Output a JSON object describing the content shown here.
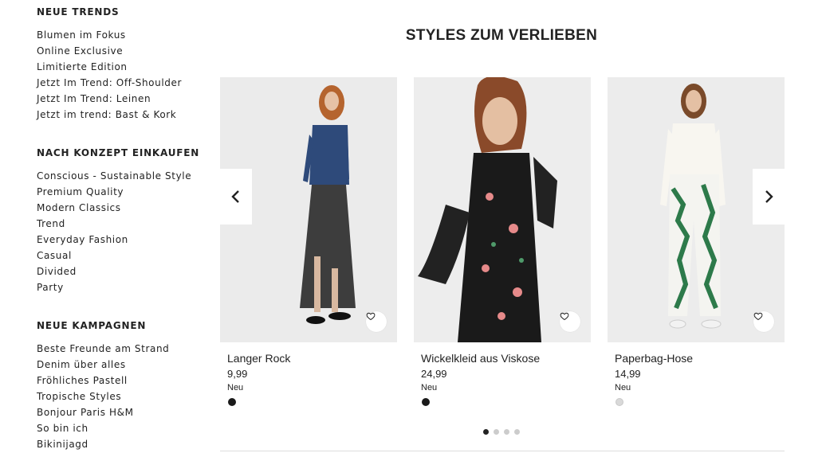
{
  "sidebar": {
    "sections": [
      {
        "heading": "NEUE TRENDS",
        "items": [
          "Blumen im Fokus",
          "Online Exclusive",
          "Limitierte Edition",
          "Jetzt Im Trend: Off-Shoulder",
          "Jetzt Im Trend: Leinen",
          "Jetzt im trend: Bast & Kork"
        ]
      },
      {
        "heading": "NACH KONZEPT EINKAUFEN",
        "items": [
          "Conscious - Sustainable Style",
          "Premium Quality",
          "Modern Classics",
          "Trend",
          "Everyday Fashion",
          "Casual",
          "Divided",
          "Party"
        ]
      },
      {
        "heading": "NEUE KAMPAGNEN",
        "items": [
          "Beste Freunde am Strand",
          "Denim über alles",
          "Fröhliches Pastell",
          "Tropische Styles",
          "Bonjour Paris H&M",
          "So bin ich",
          "Bikinijagd"
        ]
      }
    ]
  },
  "main": {
    "title": "STYLES ZUM VERLIEBEN",
    "products": [
      {
        "name": "Langer Rock",
        "price": "9,99",
        "badge": "Neu",
        "swatch_color": "#1a1a1a"
      },
      {
        "name": "Wickelkleid aus Viskose",
        "price": "24,99",
        "badge": "Neu",
        "swatch_color": "#1a1a1a"
      },
      {
        "name": "Paperbag-Hose",
        "price": "14,99",
        "badge": "Neu",
        "swatch_color": "#d9d9d9"
      }
    ],
    "carousel": {
      "page_count": 4,
      "active_page": 1
    },
    "icons": {
      "prev": "chevron-left-icon",
      "next": "chevron-right-icon",
      "favorite": "heart-icon"
    }
  }
}
